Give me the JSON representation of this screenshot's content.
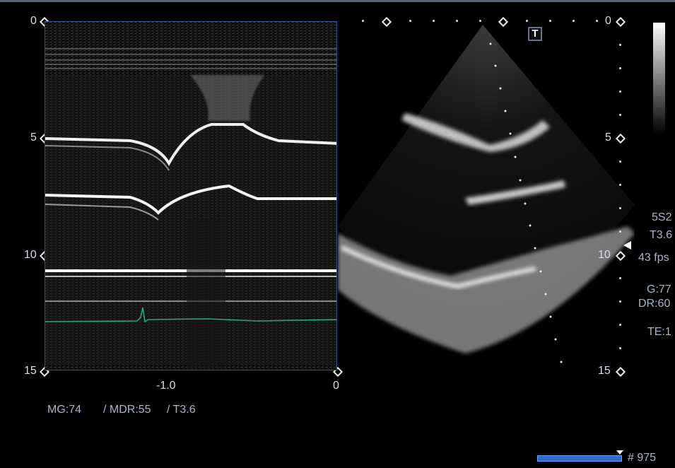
{
  "depth_scale": {
    "left": [
      "0",
      "5",
      "10",
      "15"
    ],
    "right": [
      "0",
      "5",
      "10",
      "15"
    ]
  },
  "time_axis": {
    "ticks": [
      "-1.0",
      "0"
    ]
  },
  "mmode_params": {
    "mg": "MG:74",
    "mdr": "/ MDR:55",
    "probe": "/ T3.6"
  },
  "side_params": {
    "probe": "5S2",
    "harmonic": "T3.6",
    "fps": "43 fps",
    "gain": "G:77",
    "dynamic_range": "DR:60",
    "te": "TE:1"
  },
  "badge": {
    "label": "T"
  },
  "frame": {
    "number": "# 975",
    "scrub_position": 0.97
  },
  "colors": {
    "ecg": "#1fae72",
    "frame_border": "#3c4a9a",
    "scrub": "#2b6cd0"
  }
}
